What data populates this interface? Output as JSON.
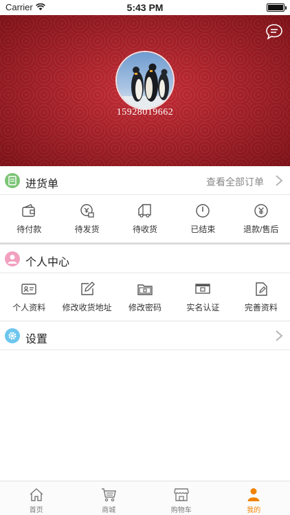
{
  "status_bar": {
    "carrier": "Carrier",
    "time": "5:43 PM"
  },
  "profile": {
    "phone": "15928019662"
  },
  "orders": {
    "title": "进货单",
    "view_all": "查看全部订单",
    "items": [
      {
        "label": "待付款",
        "icon": "wallet-icon"
      },
      {
        "label": "待发货",
        "icon": "shipping-box-icon"
      },
      {
        "label": "待收货",
        "icon": "delivery-truck-icon"
      },
      {
        "label": "已结束",
        "icon": "clock-icon"
      },
      {
        "label": "退款/售后",
        "icon": "refund-icon"
      }
    ]
  },
  "personal": {
    "title": "个人中心",
    "items": [
      {
        "label": "个人资料",
        "icon": "id-card-icon"
      },
      {
        "label": "修改收货地址",
        "icon": "edit-icon"
      },
      {
        "label": "修改密码",
        "icon": "folder-lock-icon"
      },
      {
        "label": "实名认证",
        "icon": "certificate-icon"
      },
      {
        "label": "完善资料",
        "icon": "document-edit-icon"
      }
    ]
  },
  "settings": {
    "title": "设置"
  },
  "tabbar": {
    "items": [
      {
        "label": "首页",
        "icon": "home-icon",
        "active": false
      },
      {
        "label": "商城",
        "icon": "cart-icon",
        "active": false
      },
      {
        "label": "购物车",
        "icon": "store-icon",
        "active": false
      },
      {
        "label": "我的",
        "icon": "person-icon",
        "active": true
      }
    ]
  },
  "colors": {
    "accent": "#f08300",
    "hero": "#c01a24",
    "orders_icon": "#7cc576",
    "personal_icon": "#f2a0c0",
    "settings_icon": "#6cc6ee"
  }
}
